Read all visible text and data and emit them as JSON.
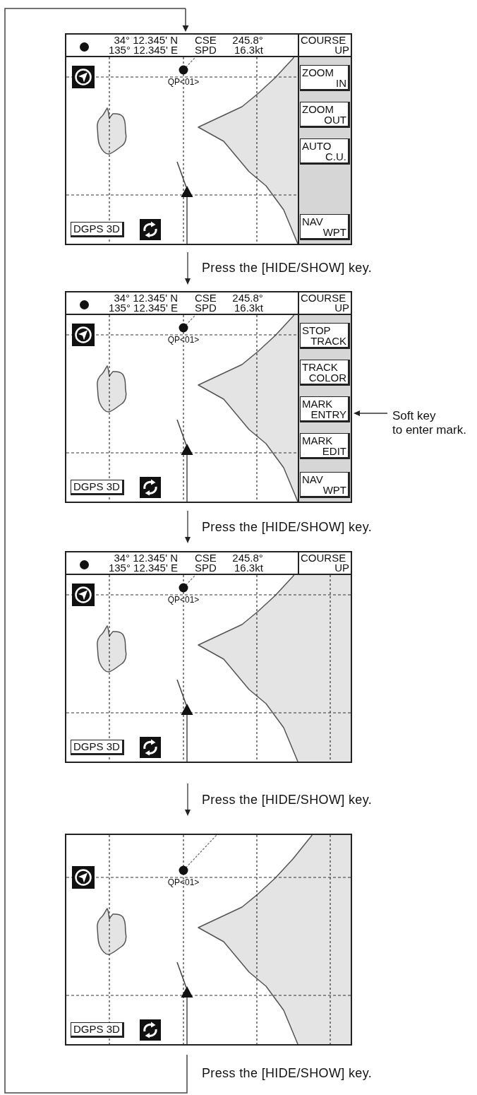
{
  "steps": [
    {
      "screen": {
        "header": {
          "latitude": "34° 12.345' N",
          "longitude": "135° 12.345' E",
          "course_label": "CSE",
          "course_value": "245.8°",
          "speed_label": "SPD",
          "speed_value": "16.3kt",
          "orientation": [
            "COURSE",
            "UP"
          ]
        },
        "waypoint_label": "QP<01>",
        "fix_status": "DGPS 3D",
        "soft_keys": [
          {
            "lines": [
              "ZOOM",
              "IN"
            ]
          },
          {
            "lines": [
              "ZOOM",
              "OUT"
            ]
          },
          {
            "lines": [
              "AUTO",
              "C.U."
            ]
          },
          {
            "lines": [
              "NAV",
              "WPT"
            ]
          }
        ]
      },
      "caption": "Press the [HIDE/SHOW] key."
    },
    {
      "screen": {
        "header": {
          "latitude": "34° 12.345' N",
          "longitude": "135° 12.345' E",
          "course_label": "CSE",
          "course_value": "245.8°",
          "speed_label": "SPD",
          "speed_value": "16.3kt",
          "orientation": [
            "COURSE",
            "UP"
          ]
        },
        "waypoint_label": "QP<01>",
        "fix_status": "DGPS 3D",
        "soft_keys": [
          {
            "lines": [
              "STOP",
              "TRACK"
            ]
          },
          {
            "lines": [
              "TRACK",
              "COLOR"
            ]
          },
          {
            "lines": [
              "MARK",
              "ENTRY"
            ]
          },
          {
            "lines": [
              "MARK",
              "EDIT"
            ]
          },
          {
            "lines": [
              "NAV",
              "WPT"
            ]
          }
        ]
      },
      "annotation": {
        "lines": [
          "Soft key",
          "to enter mark."
        ]
      },
      "caption": "Press the [HIDE/SHOW] key."
    },
    {
      "screen": {
        "header": {
          "latitude": "34° 12.345' N",
          "longitude": "135° 12.345' E",
          "course_label": "CSE",
          "course_value": "245.8°",
          "speed_label": "SPD",
          "speed_value": "16.3kt",
          "orientation": [
            "COURSE",
            "UP"
          ]
        },
        "waypoint_label": "QP<01>",
        "fix_status": "DGPS 3D"
      },
      "caption": "Press the [HIDE/SHOW] key."
    },
    {
      "screen": {
        "waypoint_label": "QP<01>",
        "fix_status": "DGPS 3D"
      },
      "caption": "Press the [HIDE/SHOW] key."
    }
  ]
}
